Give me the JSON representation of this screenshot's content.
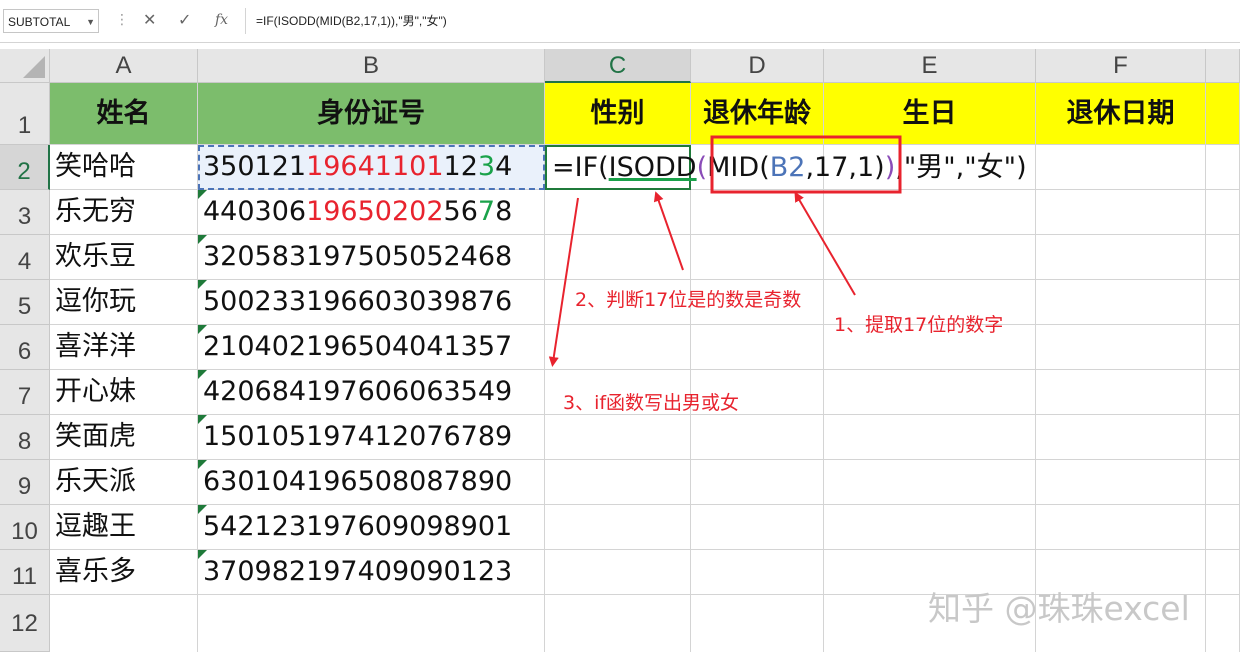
{
  "formula_bar": {
    "name_box": "SUBTOTAL",
    "cancel_symbol": "✕",
    "enter_symbol": "✓",
    "fx_symbol": "fx",
    "formula": "=IF(ISODD(MID(B2,17,1)),\"男\",\"女\")"
  },
  "columns": [
    "A",
    "B",
    "C",
    "D",
    "E",
    "F"
  ],
  "rows": [
    "1",
    "2",
    "3",
    "4",
    "5",
    "6",
    "7",
    "8",
    "9",
    "10",
    "11",
    "12"
  ],
  "headers": {
    "name": "姓名",
    "id": "身份证号",
    "gender": "性别",
    "retire_age": "退休年龄",
    "birthday": "生日",
    "retire_date": "退休日期"
  },
  "data_rows": [
    {
      "name": "笑哈哈",
      "id_segments": [
        {
          "t": "350121",
          "c": "black"
        },
        {
          "t": "19641101",
          "c": "red"
        },
        {
          "t": "12",
          "c": "black"
        },
        {
          "t": "3",
          "c": "green"
        },
        {
          "t": "4",
          "c": "black"
        }
      ]
    },
    {
      "name": "乐无穷",
      "id_segments": [
        {
          "t": "440306",
          "c": "black"
        },
        {
          "t": "19650202",
          "c": "red"
        },
        {
          "t": "56",
          "c": "black"
        },
        {
          "t": "7",
          "c": "green"
        },
        {
          "t": "8",
          "c": "black"
        }
      ]
    },
    {
      "name": "欢乐豆",
      "id_segments": [
        {
          "t": "320583197505052468",
          "c": "black"
        }
      ]
    },
    {
      "name": "逗你玩",
      "id_segments": [
        {
          "t": "500233196603039876",
          "c": "black"
        }
      ]
    },
    {
      "name": "喜洋洋",
      "id_segments": [
        {
          "t": "210402196504041357",
          "c": "black"
        }
      ]
    },
    {
      "name": "开心妹",
      "id_segments": [
        {
          "t": "420684197606063549",
          "c": "black"
        }
      ]
    },
    {
      "name": "笑面虎",
      "id_segments": [
        {
          "t": "150105197412076789",
          "c": "black"
        }
      ]
    },
    {
      "name": "乐天派",
      "id_segments": [
        {
          "t": "630104196508087890",
          "c": "black"
        }
      ]
    },
    {
      "name": "逗趣王",
      "id_segments": [
        {
          "t": "542123197609098901",
          "c": "black"
        }
      ]
    },
    {
      "name": "喜乐多",
      "id_segments": [
        {
          "t": "370982197409090123",
          "c": "black"
        }
      ]
    }
  ],
  "c2_formula_parts": {
    "p1": "=IF(",
    "p2": "ISODD",
    "p3": "(",
    "p4": "MID(",
    "p5": "B2",
    "p6": ",17,1",
    "p7": ")",
    "p8": ")",
    "p9": ",\"男\",\"女\")"
  },
  "annotations": {
    "a1": "1、提取17位的数字",
    "a2": "2、判断17位是的数是奇数",
    "a3": "3、if函数写出男或女"
  },
  "watermark": "知乎 @珠珠excel",
  "colors": {
    "header_green": "#7cbd6c",
    "header_yellow": "#ffff00",
    "annotation_red": "#e8232e",
    "excel_green": "#217346"
  }
}
